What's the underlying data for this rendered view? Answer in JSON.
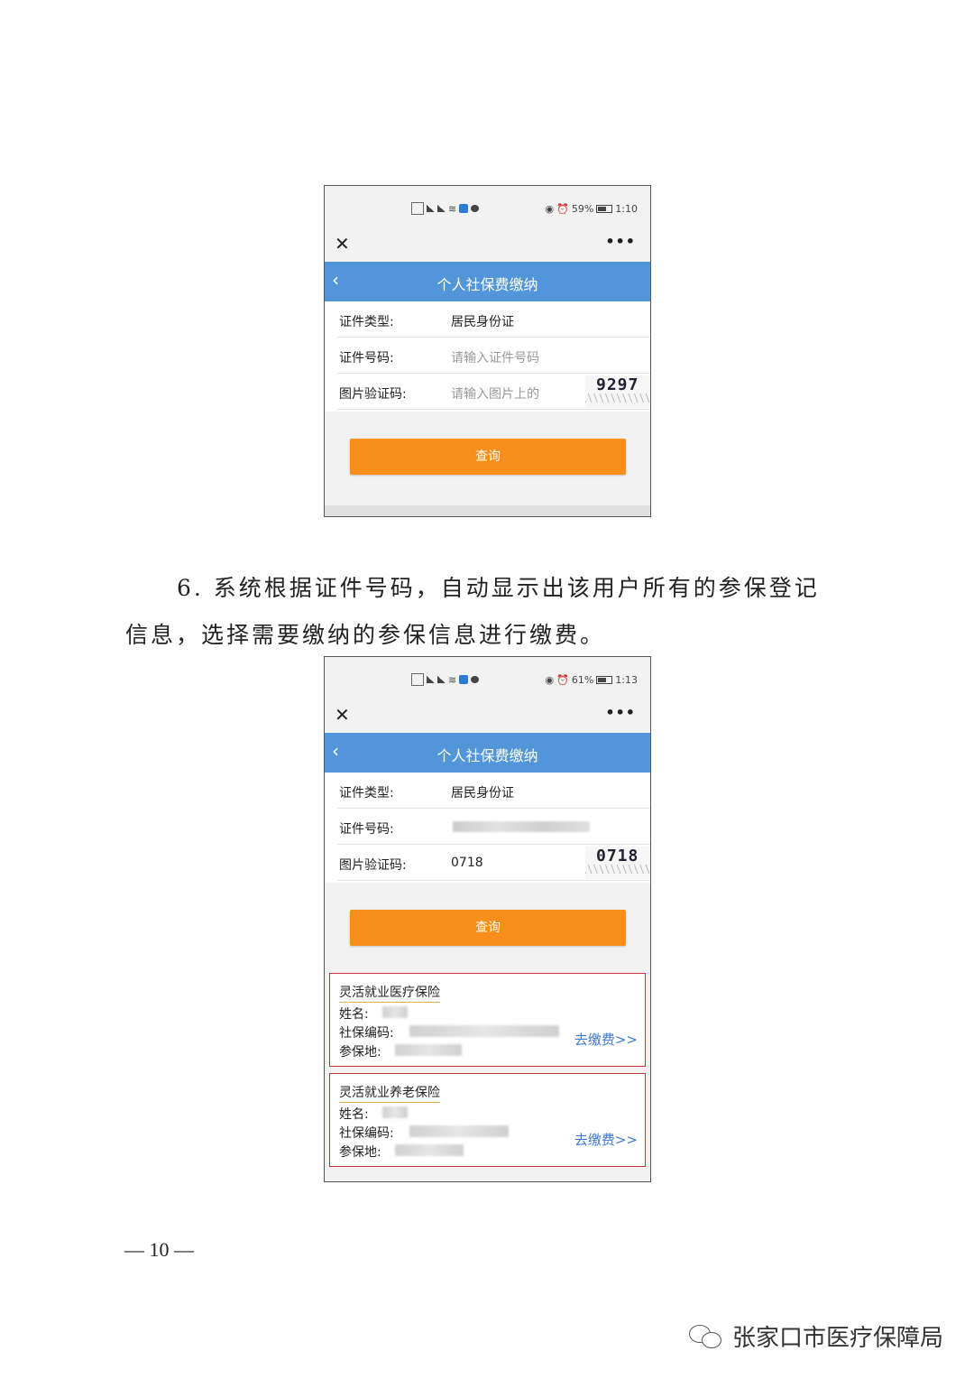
{
  "screens": [
    {
      "status": {
        "battery": "59%",
        "time": "1:10",
        "battery_fill": 0.59
      },
      "nav_title": "个人社保费缴纳",
      "fields": [
        {
          "label": "证件类型:",
          "value": "居民身份证"
        },
        {
          "label": "证件号码:",
          "placeholder": "请输入证件号码"
        },
        {
          "label": "图片验证码:",
          "placeholder": "请输入图片上的",
          "captcha": "9297"
        }
      ],
      "query_label": "查询"
    },
    {
      "status": {
        "battery": "61%",
        "time": "1:13",
        "battery_fill": 0.61
      },
      "nav_title": "个人社保费缴纳",
      "fields": [
        {
          "label": "证件类型:",
          "value": "居民身份证"
        },
        {
          "label": "证件号码:"
        },
        {
          "label": "图片验证码:",
          "value": "0718",
          "captcha": "0718"
        }
      ],
      "query_label": "查询",
      "results": [
        {
          "title": "灵活就业医疗保险",
          "name_label": "姓名:",
          "code_label": "社保编码:",
          "place_label": "参保地:",
          "action": "去缴费>>"
        },
        {
          "title": "灵活就业养老保险",
          "name_label": "姓名:",
          "code_label": "社保编码:",
          "place_label": "参保地:",
          "action": "去缴费>>"
        }
      ]
    }
  ],
  "paragraph": {
    "line1": "6. 系统根据证件号码，自动显示出该用户所有的参保登记",
    "line2": "信息，选择需要缴纳的参保信息进行缴费。"
  },
  "page_number": "— 10 —",
  "watermark": "张家口市医疗保障局",
  "colors": {
    "nav": "#5296d9",
    "button": "#f88e1c",
    "card_border": "#d0303a",
    "link": "#3f7ad2"
  }
}
